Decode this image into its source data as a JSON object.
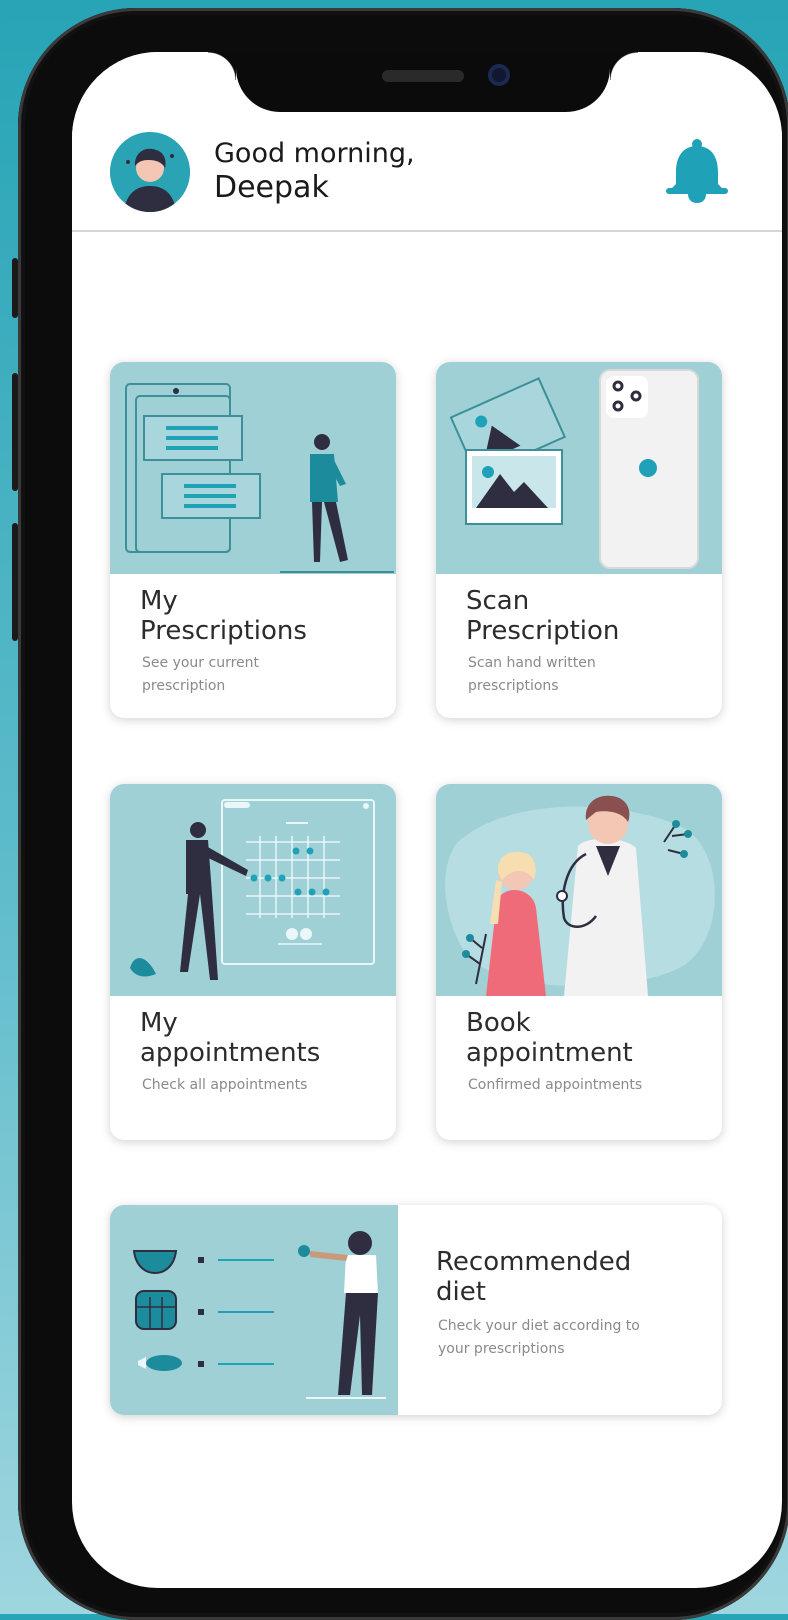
{
  "header": {
    "greeting": "Good morning,",
    "user_name": "Deepak",
    "avatar_icon": "user-avatar-icon",
    "notification_icon": "bell-icon"
  },
  "cards": [
    {
      "title_line1": "My",
      "title_line2": "Prescriptions",
      "subtitle": "See your current prescription",
      "illustration": "prescription-list-illustration"
    },
    {
      "title_line1": "Scan",
      "title_line2": "Prescription",
      "subtitle": "Scan hand written prescriptions",
      "illustration": "phone-scan-illustration"
    },
    {
      "title_line1": "My",
      "title_line2": "appointments",
      "subtitle": "Check all appointments",
      "illustration": "calendar-board-illustration"
    },
    {
      "title_line1": "Book",
      "title_line2": "appointment",
      "subtitle": "Confirmed appointments",
      "illustration": "doctor-patient-illustration"
    }
  ],
  "diet_card": {
    "title_line1": "Recommended",
    "title_line2": "diet",
    "subtitle": "Check your diet according to your prescriptions",
    "illustration": "diet-list-illustration"
  },
  "colors": {
    "accent": "#1fa2b8",
    "illustration_bg": "#9fd0d6",
    "dark_figure": "#2f2e41",
    "text": "#2c2c2c",
    "subtext": "#8a8a8a",
    "background_top": "#27a4b6"
  }
}
